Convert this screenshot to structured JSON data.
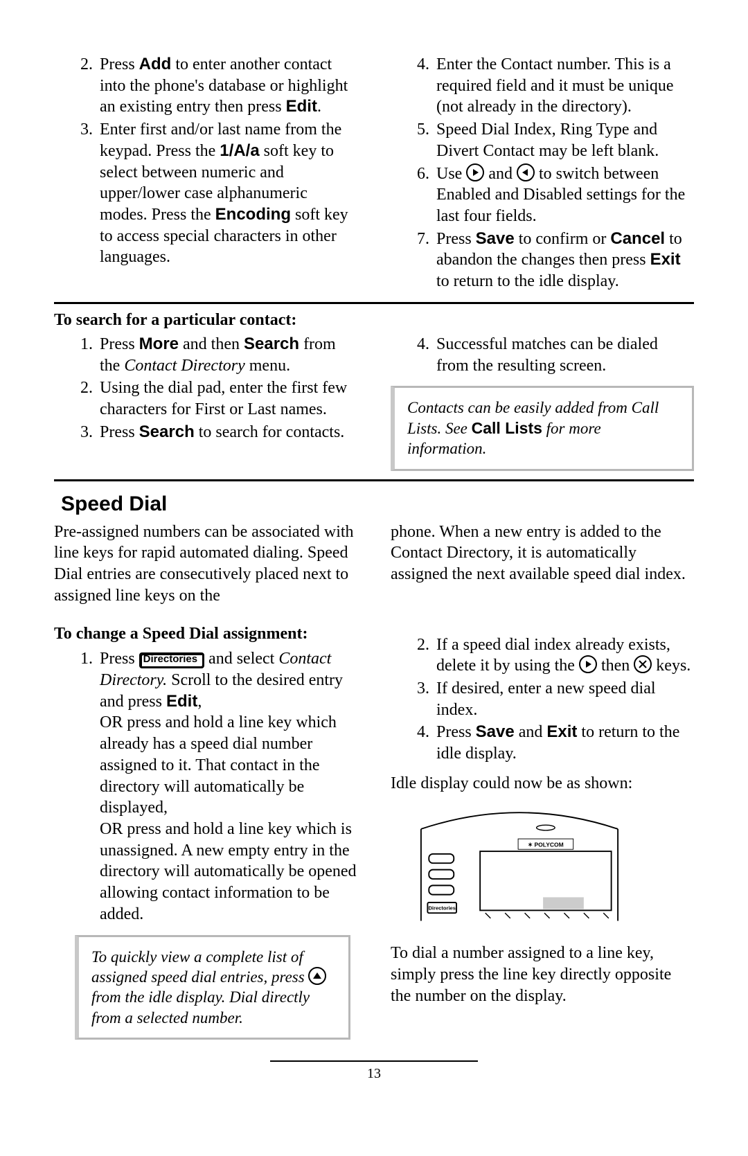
{
  "section1": {
    "left": {
      "item2": {
        "pre": "Press ",
        "b1": "Add",
        "mid": " to enter another contact into the phone's database or highlight an existing entry then press ",
        "b2": "Edit",
        "post": "."
      },
      "item3": {
        "pre": "Enter first and/or last name from the keypad.  Press the ",
        "b1": "1/A/a",
        "mid1": " soft key to select between numeric and upper/lower case alphanumeric modes. Press the ",
        "b2": "Encoding",
        "mid2": " soft key to access special characters in other languages."
      }
    },
    "right": {
      "item4": "Enter the Contact number.  This is a required field and it must be unique (not already in the directory).",
      "item5": "Speed Dial Index, Ring Type and Divert Contact may be left blank.",
      "item6_pre": "Use ",
      "item6_mid": " and ",
      "item6_post": " to switch between Enabled and Disabled settings for the last four fields.",
      "item7_pre": "Press ",
      "item7_b1": "Save",
      "item7_mid1": " to confirm or ",
      "item7_b2": "Cancel",
      "item7_mid2": " to abandon the changes then press ",
      "item7_b3": "Exit",
      "item7_post": " to return to the idle display."
    }
  },
  "search": {
    "heading": "To search for a particular contact:",
    "left": {
      "i1_pre": "Press ",
      "i1_b1": "More",
      "i1_mid": " and then ",
      "i1_b2": "Search",
      "i1_post": " from the ",
      "i1_ital": "Contact Directory",
      "i1_end": " menu.",
      "i2": "Using the dial pad, enter the first few characters for First or Last names.",
      "i3_pre": "Press ",
      "i3_b": "Search",
      "i3_post": " to search for contacts."
    },
    "right": {
      "i4": "Successful matches can be dialed from the resulting screen.",
      "callout_pre": "Contacts can be easily added from Call Lists.  See ",
      "callout_b": "Call Lists",
      "callout_post": " for more information."
    }
  },
  "speed": {
    "title": "Speed Dial",
    "intro": "Pre-assigned numbers can be associated with line keys for rapid automated dialing.  Speed Dial entries are consecutively placed next to assigned line keys on the phone.  When a new entry is added to the Contact Directory, it is automatically assigned the next available speed dial index.",
    "sub": "To change a Speed Dial assignment:",
    "left": {
      "i1_pre": "Press ",
      "i1_key": "Directories",
      "i1_mid": " and select ",
      "i1_ital": "Contact Directory.",
      "i1_post1": "  Scroll to the desired entry and press ",
      "i1_b": "Edit",
      "i1_post2": ",",
      "i1_p2": "OR press and hold a line key which already has a speed dial number assigned to it.  That contact in the directory will automatically be displayed,",
      "i1_p3": "OR press and hold a line key which is unassigned.  A new empty entry in the directory will automatically be opened allowing contact information to be added.",
      "callout_pre": "To quickly view a complete list of assigned speed dial entries, press ",
      "callout_post": " from the idle display.  Dial directly from a selected number."
    },
    "right": {
      "i2_pre": "If a speed dial index already exists, delete it by using the ",
      "i2_mid": " then ",
      "i2_post": " keys.",
      "i3": "If desired, enter a new speed dial index.",
      "i4_pre": "Press ",
      "i4_b1": "Save",
      "i4_mid": " and ",
      "i4_b2": "Exit",
      "i4_post": " to return to the idle display.",
      "idle": "Idle display could now be as shown:",
      "dial": "To dial a number assigned to a line key, simply press the line key directly opposite the number on the display."
    },
    "phone_label1": "POLYCOM",
    "phone_label2": "Directories"
  },
  "page_number": "13"
}
